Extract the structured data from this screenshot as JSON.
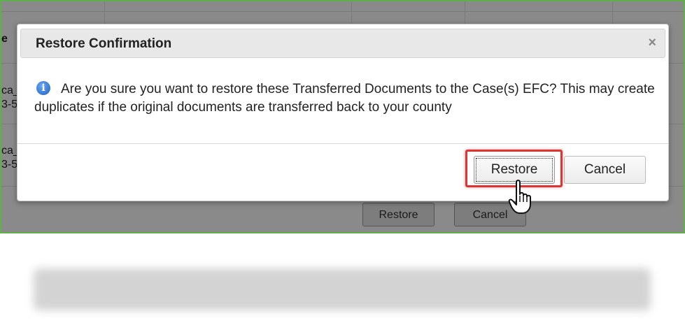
{
  "background": {
    "partial_texts": [
      "e",
      "ca_",
      "3-5",
      "ca_",
      "3-5"
    ],
    "buttons": {
      "restore_label": "Restore",
      "cancel_label": "Cancel"
    }
  },
  "dialog": {
    "title": "Restore Confirmation",
    "close_glyph": "×",
    "info_glyph": "i",
    "message": "Are you sure you want to restore these Transferred Documents to the Case(s) EFC? This may create duplicates if the original documents are transferred back to your county",
    "restore_label": "Restore",
    "cancel_label": "Cancel"
  },
  "colors": {
    "frame_border": "#5fb04a",
    "highlight": "#e03434",
    "info_icon": "#1f62c4",
    "overlay": "#8a8a8a"
  },
  "icons": {
    "close": "close-icon",
    "info": "info-icon",
    "cursor": "hand-pointer-icon"
  }
}
